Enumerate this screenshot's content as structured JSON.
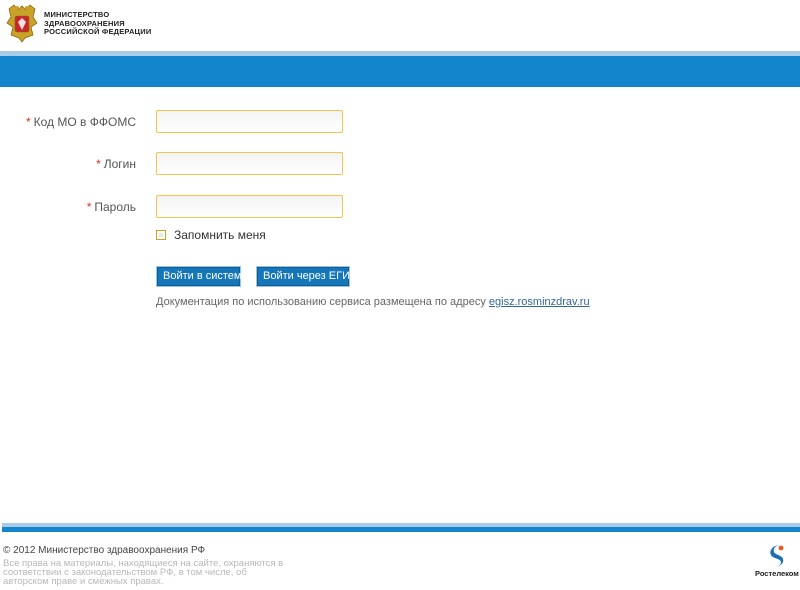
{
  "header": {
    "ministry_line1": "МИНИСТЕРСТВО",
    "ministry_line2": "ЗДРАВООХРАНЕНИЯ",
    "ministry_line3": "РОССИЙСКОЙ ФЕДЕРАЦИИ",
    "emblem_icon": "coat-of-arms-icon"
  },
  "form": {
    "required_mark": "*",
    "fields": [
      {
        "label": "Код МО в ФФОМС",
        "value": "",
        "placeholder": ""
      },
      {
        "label": "Логин",
        "value": "",
        "placeholder": ""
      },
      {
        "label": "Пароль",
        "value": "",
        "placeholder": ""
      }
    ],
    "remember_label": "Запомнить меня",
    "remember_checked": false,
    "login_button": "Войти в систему",
    "egis_button": "Войти через ЕГИС",
    "doc_text": "Документация по использованию сервиса размещена по адресу",
    "doc_link": "egisz.rosminzdrav.ru"
  },
  "footer": {
    "copyright": "© 2012 Министерство здравоохранения РФ",
    "rights_line1": "Все права на материалы, находящиеся на сайте, охраняются в",
    "rights_line2": "соответствии с законодательством РФ, в том числе, об",
    "rights_line3": "авторском праве и смежных правах.",
    "rt_name": "Ростелеком",
    "rt_icon": "rostelecom-logo-icon"
  },
  "colors": {
    "brand_blue": "#1385cc",
    "light_blue": "#a9cbe8",
    "input_border": "#f0c550",
    "required": "#e0301e"
  }
}
